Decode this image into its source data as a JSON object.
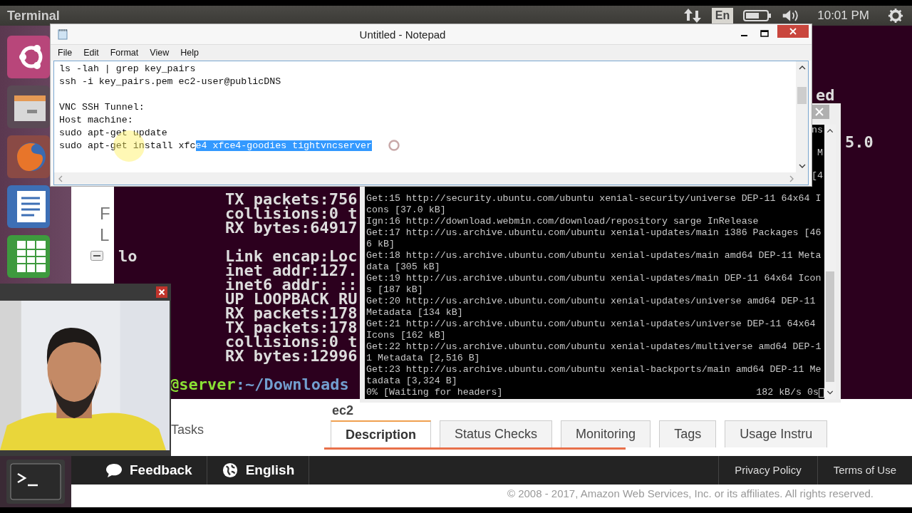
{
  "top_panel": {
    "title": "Terminal",
    "keyboard_layout": "En",
    "time": "10:01 PM"
  },
  "notepad": {
    "title": "Untitled - Notepad",
    "menu": [
      "File",
      "Edit",
      "Format",
      "View",
      "Help"
    ],
    "paragraphs": [
      [
        {
          "text": "ls -lah | grep key_pairs"
        },
        {
          "text": "ssh -i key_pairs.pem ec2-user@publicDNS"
        }
      ],
      [
        {
          "text": "VNC SSH Tunnel:"
        },
        {
          "text": "Host machine:"
        },
        {
          "text": "sudo apt-get update"
        },
        {
          "text": "sudo apt-get install xfc",
          "selected_text": "e4 xfce4-goodies tightvncserver"
        }
      ]
    ]
  },
  "background_terminal": {
    "fragments": [
      "ed",
      "5.0"
    ],
    "blocks": [
      {
        "lines": [
          "TX packets:756",
          "collisions:0 t",
          "RX bytes:64917"
        ]
      },
      {
        "interface": "lo",
        "lines": [
          "Link encap:Loc",
          "inet addr:127.",
          "inet6 addr: ::",
          "UP LOOPBACK RU",
          "RX packets:178",
          "TX packets:178",
          "collisions:0 t",
          "RX bytes:12996"
        ]
      }
    ],
    "prompt": {
      "host": "@server",
      "path": ":~/Downloads"
    }
  },
  "apt_terminal": {
    "cut_rows": [
      "ns",
      "",
      "M",
      "",
      "[4",
      ""
    ],
    "lines": [
      "Get:15 http://security.ubuntu.com/ubuntu xenial-security/universe DEP-11 64x64 I",
      "cons [37.0 kB]",
      "Ign:16 http://download.webmin.com/download/repository sarge InRelease",
      "Get:17 http://us.archive.ubuntu.com/ubuntu xenial-updates/main i386 Packages [46",
      "6 kB]",
      "Get:18 http://us.archive.ubuntu.com/ubuntu xenial-updates/main amd64 DEP-11 Meta",
      "data [305 kB]",
      "Get:19 http://us.archive.ubuntu.com/ubuntu xenial-updates/main DEP-11 64x64 Icon",
      "s [187 kB]",
      "Get:20 http://us.archive.ubuntu.com/ubuntu xenial-updates/universe amd64 DEP-11",
      "Metadata [134 kB]",
      "Get:21 http://us.archive.ubuntu.com/ubuntu xenial-updates/universe DEP-11 64x64",
      "Icons [162 kB]",
      "Get:22 http://us.archive.ubuntu.com/ubuntu xenial-updates/multiverse amd64 DEP-1",
      "1 Metadata [2,516 B]",
      "Get:23 http://us.archive.ubuntu.com/ubuntu xenial-backports/main amd64 DEP-11 Me",
      "tadata [3,324 B]"
    ],
    "status_left": "0% [Waiting for headers]",
    "status_right": "182 kB/s 0s"
  },
  "aws_page": {
    "side_letters": [
      "F",
      "L"
    ],
    "tasks": "Tasks",
    "heading": "ec2",
    "tabs": [
      {
        "label": "Description",
        "selected": true
      },
      {
        "label": "Status Checks",
        "selected": false
      },
      {
        "label": "Monitoring",
        "selected": false
      },
      {
        "label": "Tags",
        "selected": false
      },
      {
        "label": "Usage Instru",
        "selected": false
      }
    ],
    "footer": {
      "feedback": "Feedback",
      "language": "English",
      "links": [
        "Privacy Policy",
        "Terms of Use"
      ],
      "copyright": "© 2008 - 2017, Amazon Web Services, Inc. or its affiliates. All rights reserved."
    }
  }
}
